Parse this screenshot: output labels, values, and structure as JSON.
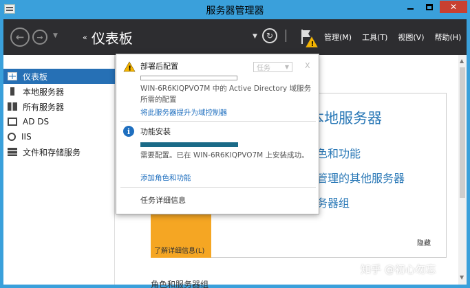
{
  "window": {
    "title": "服务器管理器"
  },
  "navbar": {
    "page_title": "仪表板",
    "breadcrumb_chevron": "‹‹",
    "menus": [
      "管理(M)",
      "工具(T)",
      "视图(V)",
      "帮助(H)"
    ]
  },
  "sidebar": {
    "items": [
      {
        "label": "仪表板",
        "icon": "dashboard-icon",
        "active": true
      },
      {
        "label": "本地服务器",
        "icon": "server-icon"
      },
      {
        "label": "所有服务器",
        "icon": "servers-icon"
      },
      {
        "label": "AD DS",
        "icon": "adds-icon"
      },
      {
        "label": "IIS",
        "icon": "iis-icon"
      },
      {
        "label": "文件和存储服务",
        "icon": "file-storage-icon"
      }
    ]
  },
  "main": {
    "heading": "本地服务器",
    "links": [
      "色和功能",
      "管理的其他服务器",
      "务器组"
    ],
    "learn_more": "了解详细信息(L)",
    "hide": "隐藏",
    "roles_heading": "角色和服务器组"
  },
  "notifications": {
    "post_deploy": {
      "title": "部署后配置",
      "task_label": "任务",
      "close": "X",
      "text": "WIN-6R6KIQPVO7M 中的 Active Directory 域服务所需的配置",
      "link": "将此服务器提升为域控制器"
    },
    "feature_install": {
      "title": "功能安装",
      "progress": 1.0,
      "text": "需要配置。已在 WIN-6R6KIQPVO7M 上安装成功。",
      "link": "添加角色和功能"
    },
    "task_details": "任务详细信息"
  },
  "watermark": "知乎 @初心勿忘",
  "colors": {
    "title_bar": "#3aa0db",
    "nav_bar": "#2d2d30",
    "active_item": "#2670b5",
    "link": "#1f6fbf",
    "accent_orange": "#f5a623",
    "close_button": "#c84031"
  }
}
